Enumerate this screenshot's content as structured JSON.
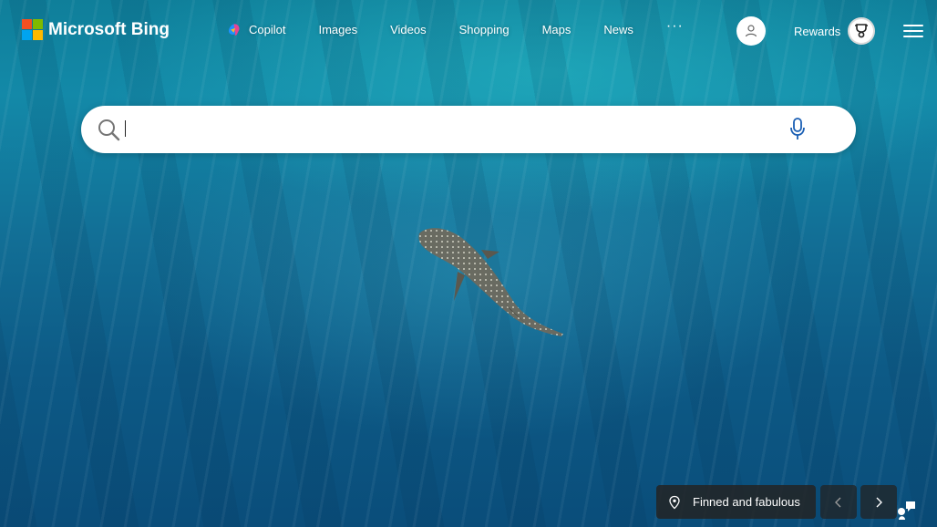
{
  "header": {
    "logo_text": "Microsoft Bing",
    "nav": [
      {
        "label": "Copilot"
      },
      {
        "label": "Images"
      },
      {
        "label": "Videos"
      },
      {
        "label": "Shopping"
      },
      {
        "label": "Maps"
      },
      {
        "label": "News"
      }
    ],
    "more_label": "···",
    "rewards_label": "Rewards"
  },
  "search": {
    "value": "",
    "placeholder": ""
  },
  "background": {
    "caption": "Finned and fabulous"
  },
  "colors": {
    "ms_red": "#f25022",
    "ms_green": "#7fba00",
    "ms_blue": "#00a4ef",
    "ms_yellow": "#ffb900"
  },
  "icons": {
    "search": "search-icon",
    "mic": "microphone-icon",
    "avatar": "user-icon",
    "rewards": "trophy-icon",
    "menu": "hamburger-menu-icon",
    "location": "location-pin-icon",
    "prev": "chevron-left-icon",
    "next": "chevron-right-icon",
    "feedback": "feedback-icon"
  }
}
